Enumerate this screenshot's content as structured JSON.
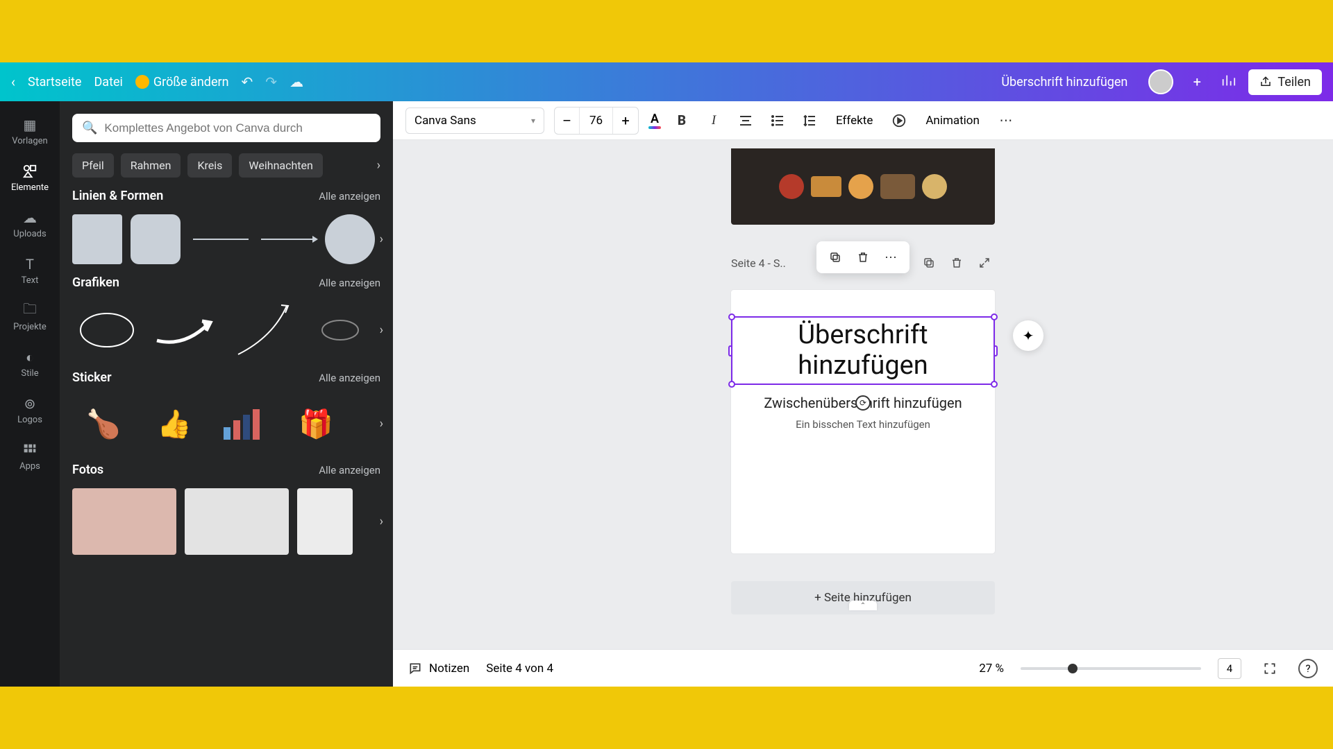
{
  "header": {
    "home": "Startseite",
    "file": "Datei",
    "resize": "Größe ändern",
    "doc_title": "Überschrift hinzufügen",
    "share": "Teilen"
  },
  "nav": {
    "templates": "Vorlagen",
    "elements": "Elemente",
    "uploads": "Uploads",
    "text": "Text",
    "projects": "Projekte",
    "styles": "Stile",
    "logos": "Logos",
    "apps": "Apps"
  },
  "panel": {
    "search_placeholder": "Komplettes Angebot von Canva durch",
    "chips": [
      "Pfeil",
      "Rahmen",
      "Kreis",
      "Weihnachten"
    ],
    "see_all": "Alle anzeigen",
    "sections": {
      "lines": "Linien & Formen",
      "graphics": "Grafiken",
      "stickers": "Sticker",
      "photos": "Fotos"
    }
  },
  "toolbar": {
    "font": "Canva Sans",
    "size": "76",
    "effects": "Effekte",
    "animation": "Animation"
  },
  "canvas": {
    "page_label": "Seite 4 - S..",
    "heading": "Überschrift hinzufügen",
    "subheading": "Zwischenüberschrift hinzufügen",
    "body": "Ein bisschen Text hinzufügen",
    "add_page": "+ Seite hinzufügen"
  },
  "footer": {
    "notes": "Notizen",
    "page_of": "Seite 4 von 4",
    "zoom": "27 %",
    "page_count": "4"
  }
}
